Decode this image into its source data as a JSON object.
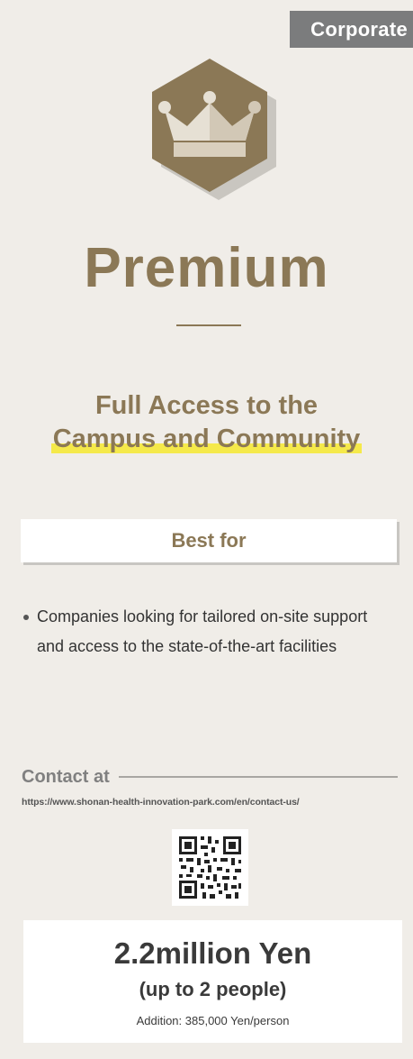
{
  "badge": {
    "label": "Corporate"
  },
  "plan": {
    "name": "Premium"
  },
  "headline": {
    "line1": "Full Access to the",
    "line2": "Campus and Community"
  },
  "best_for": {
    "label": "Best for",
    "items": [
      "Companies looking for tailored on-site support and access to the state-of-the-art facilities"
    ]
  },
  "contact": {
    "label": "Contact at",
    "url": "https://www.shonan-health-innovation-park.com/en/contact-us/"
  },
  "price": {
    "main": "2.2million Yen",
    "sub": "(up to 2 people)",
    "addition": "Addition: 385,000 Yen/person"
  },
  "colors": {
    "accent": "#8b7856",
    "badge_bg": "#7b7c7d",
    "page_bg": "#f0ede8",
    "highlight": "#f5e94a"
  },
  "icons": {
    "plan_icon": "crown-icon",
    "qr": "qr-code-icon"
  }
}
